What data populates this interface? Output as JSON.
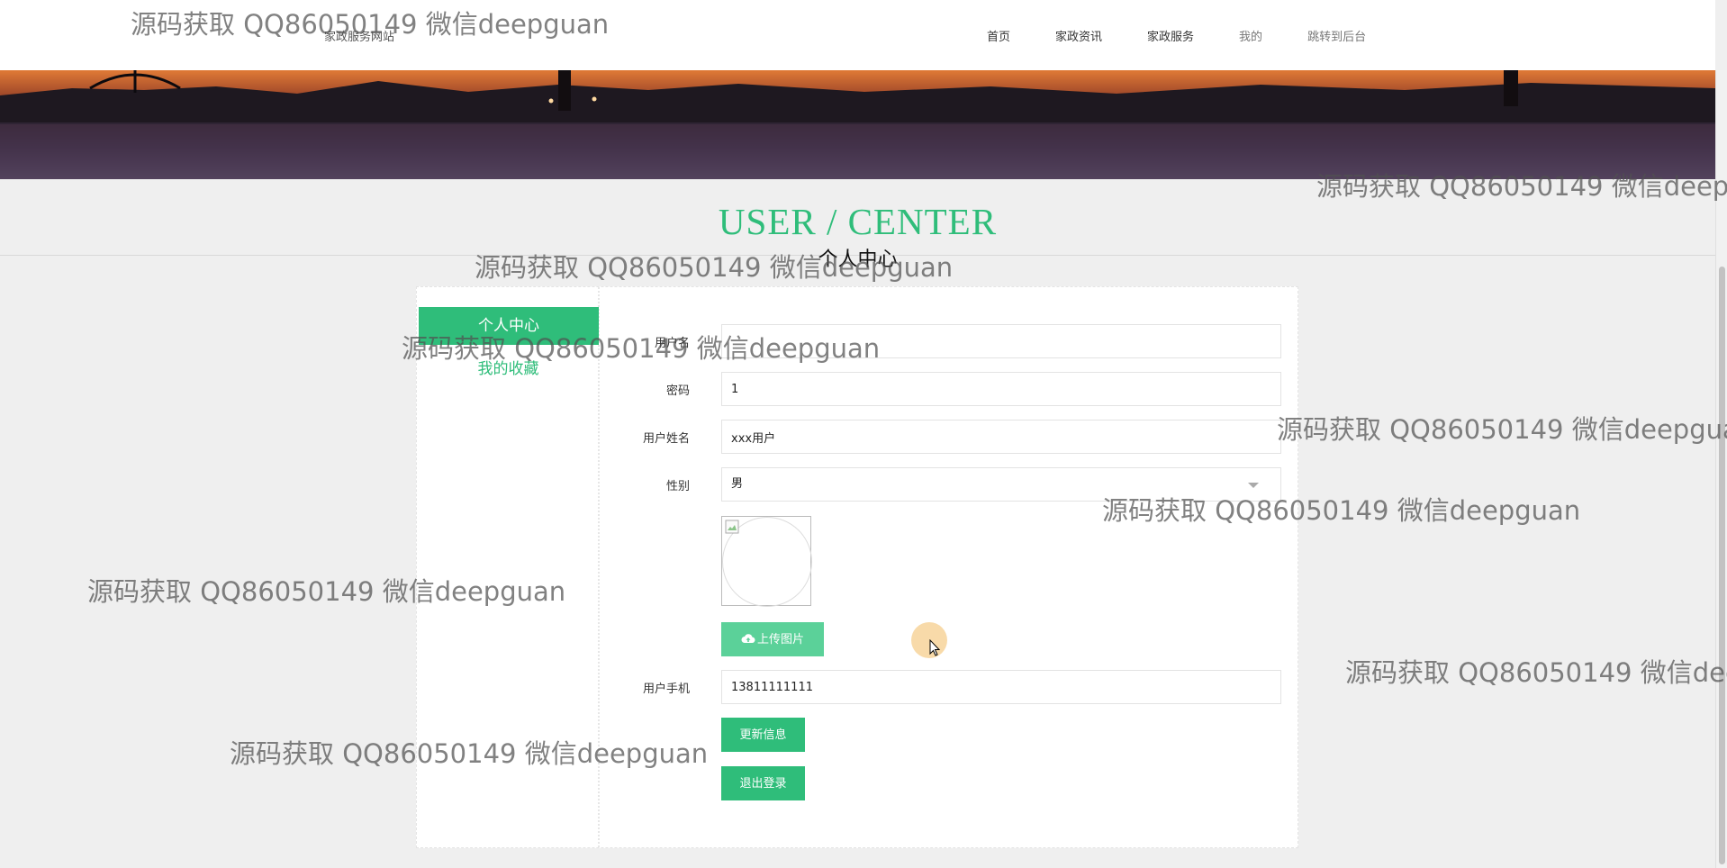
{
  "header": {
    "site_name": "家政服务网站",
    "nav": [
      "首页",
      "家政资讯",
      "家政服务",
      "我的",
      "跳转到后台"
    ]
  },
  "title": {
    "main": "USER / CENTER",
    "sub": "个人中心"
  },
  "sidebar": {
    "items": [
      "个人中心",
      "我的收藏"
    ]
  },
  "form": {
    "username_label": "用户名",
    "username_value": "",
    "password_label": "密码",
    "password_value": "1",
    "realname_label": "用户姓名",
    "realname_value": "xxx用户",
    "gender_label": "性别",
    "gender_value": "男",
    "upload_button": "上传图片",
    "phone_label": "用户手机",
    "phone_value": "13811111111",
    "update_button": "更新信息",
    "logout_button": "退出登录"
  },
  "watermark": "源码获取 QQ86050149 微信deepguan",
  "colors": {
    "accent": "#2fbd7a"
  }
}
